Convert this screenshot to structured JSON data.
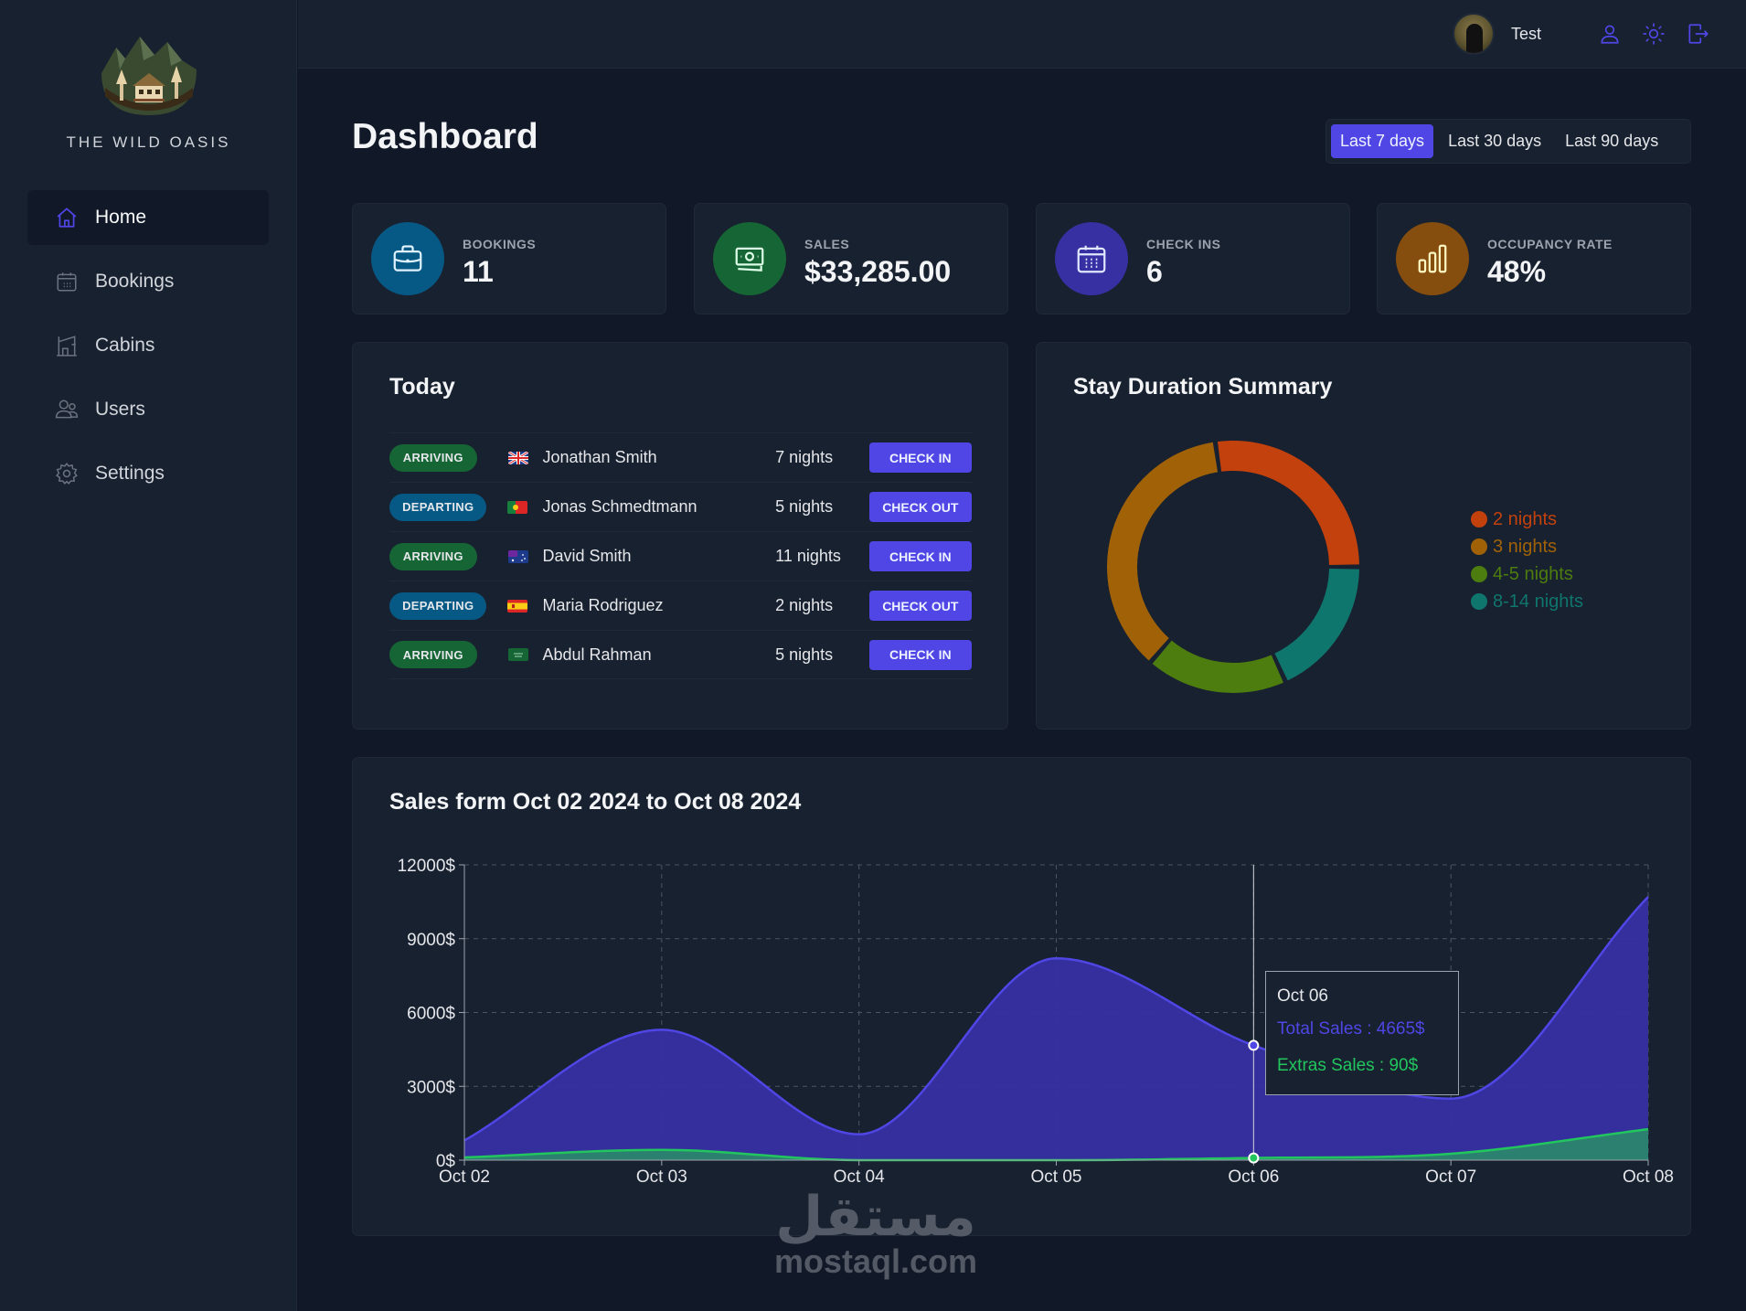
{
  "brand": {
    "name": "THE WILD OASIS"
  },
  "sidebar": {
    "items": [
      {
        "label": "Home",
        "icon": "home-icon",
        "active": true
      },
      {
        "label": "Bookings",
        "icon": "calendar-icon",
        "active": false
      },
      {
        "label": "Cabins",
        "icon": "cabin-icon",
        "active": false
      },
      {
        "label": "Users",
        "icon": "users-icon",
        "active": false
      },
      {
        "label": "Settings",
        "icon": "gear-icon",
        "active": false
      }
    ]
  },
  "header": {
    "user_name": "Test",
    "icons": [
      "user-icon",
      "sun-icon",
      "logout-icon"
    ]
  },
  "page": {
    "title": "Dashboard",
    "filters": [
      {
        "label": "Last 7 days",
        "active": true
      },
      {
        "label": "Last 30 days",
        "active": false
      },
      {
        "label": "Last 90 days",
        "active": false
      }
    ]
  },
  "stats": [
    {
      "label": "BOOKINGS",
      "value": "11",
      "icon": "briefcase-icon",
      "color": "#075985"
    },
    {
      "label": "SALES",
      "value": "$33,285.00",
      "icon": "banknotes-icon",
      "color": "#166534"
    },
    {
      "label": "CHECK INS",
      "value": "6",
      "icon": "calendar-days-icon",
      "color": "#3730a3"
    },
    {
      "label": "OCCUPANCY RATE",
      "value": "48%",
      "icon": "chart-bar-icon",
      "color": "#854d0e"
    }
  ],
  "today": {
    "title": "Today",
    "rows": [
      {
        "status": "ARRIVING",
        "flag": "uk",
        "guest": "Jonathan Smith",
        "nights": "7 nights",
        "action": "CHECK IN"
      },
      {
        "status": "DEPARTING",
        "flag": "pt",
        "guest": "Jonas Schmedtmann",
        "nights": "5 nights",
        "action": "CHECK OUT"
      },
      {
        "status": "ARRIVING",
        "flag": "au",
        "guest": "David Smith",
        "nights": "11 nights",
        "action": "CHECK IN"
      },
      {
        "status": "DEPARTING",
        "flag": "es",
        "guest": "Maria Rodriguez",
        "nights": "2 nights",
        "action": "CHECK OUT"
      },
      {
        "status": "ARRIVING",
        "flag": "sa",
        "guest": "Abdul Rahman",
        "nights": "5 nights",
        "action": "CHECK IN"
      }
    ]
  },
  "chart_data": [
    {
      "type": "pie",
      "title": "Stay Duration Summary",
      "donut": true,
      "legend_position": "right",
      "categories": [
        "2 nights",
        "3 nights",
        "4-5 nights",
        "8-14 nights"
      ],
      "values": [
        3,
        4,
        2,
        2
      ],
      "colors": [
        "#c2410c",
        "#a16207",
        "#4d7c0f",
        "#0f766e"
      ]
    },
    {
      "type": "area",
      "title": "Sales form Oct 02 2024 to Oct 08 2024",
      "xlabel": "",
      "ylabel": "",
      "x": [
        "Oct 02",
        "Oct 03",
        "Oct 04",
        "Oct 05",
        "Oct 06",
        "Oct 07",
        "Oct 08"
      ],
      "ylim": [
        0,
        12000
      ],
      "yticks": [
        0,
        3000,
        6000,
        9000,
        12000
      ],
      "ytick_labels": [
        "0$",
        "3000$",
        "6000$",
        "9000$",
        "12000$"
      ],
      "grid": true,
      "series": [
        {
          "name": "Total Sales",
          "values": [
            800,
            5300,
            1050,
            8200,
            4665,
            2500,
            10700
          ],
          "color": "#4f46e5"
        },
        {
          "name": "Extras Sales",
          "values": [
            110,
            420,
            0,
            0,
            90,
            260,
            1260
          ],
          "color": "#22c55e"
        }
      ],
      "tooltip": {
        "x": "Oct 06",
        "title": "Oct 06",
        "lines": [
          "Total Sales : 4665$",
          "Extras Sales : 90$"
        ]
      }
    }
  ],
  "watermark": {
    "arabic": "مستقل",
    "latin": "mostaql.com"
  }
}
